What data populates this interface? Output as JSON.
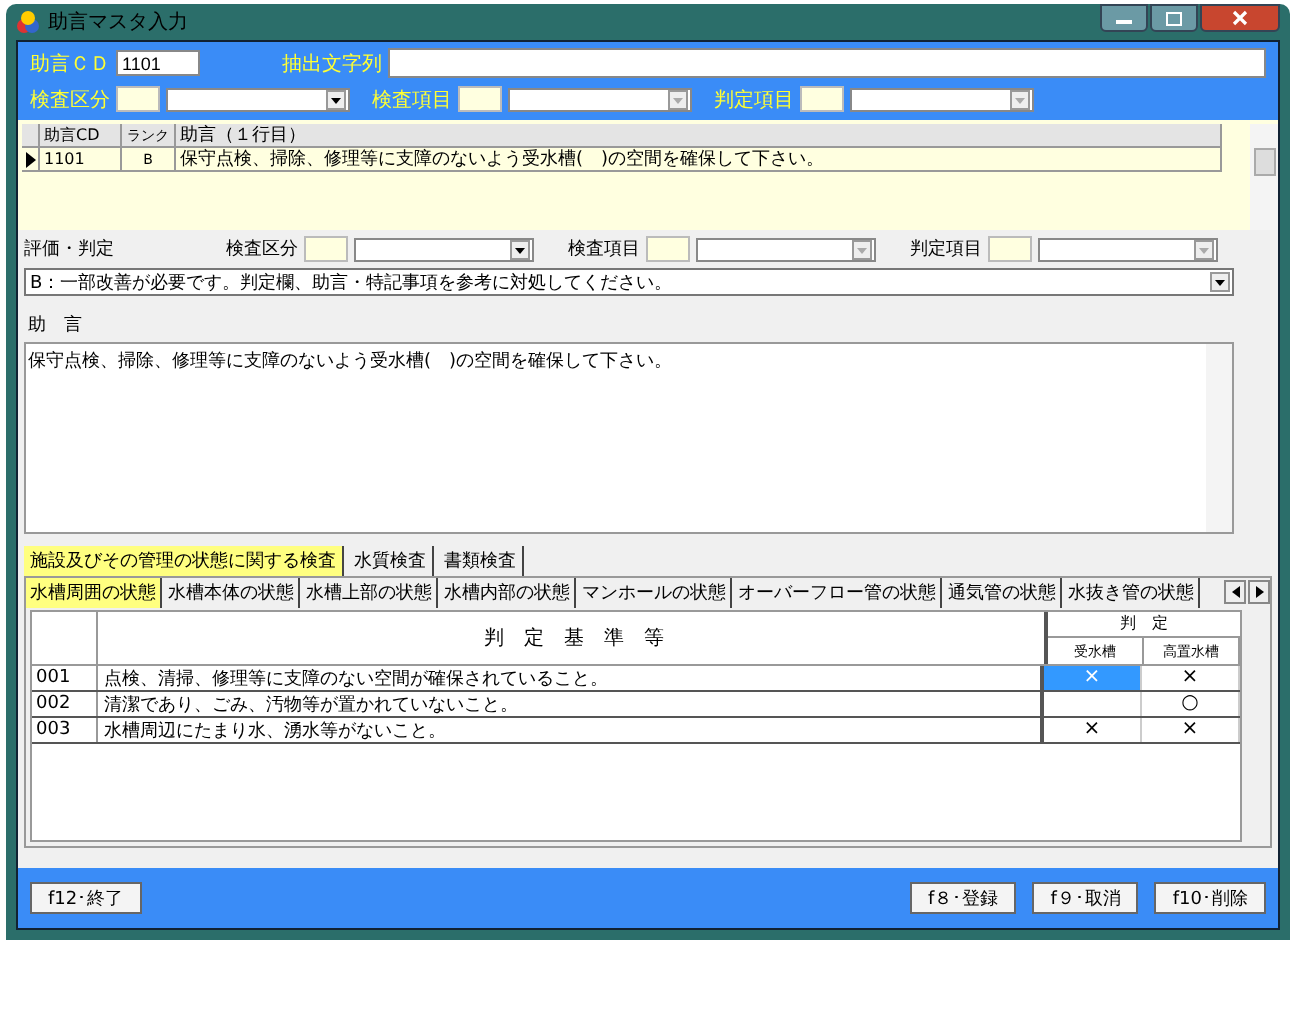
{
  "window": {
    "title": "助言マスタ入力"
  },
  "search": {
    "cd_label": "助言ＣＤ",
    "cd_value": "1101",
    "extract_label": "抽出文字列",
    "filters": [
      {
        "label": "検査区分",
        "disabled": false
      },
      {
        "label": "検査項目",
        "disabled": true
      },
      {
        "label": "判定項目",
        "disabled": true
      }
    ]
  },
  "grid": {
    "columns": [
      "助言CD",
      "ランク",
      "助言（１行目）"
    ],
    "rows": [
      {
        "selected": true,
        "cd": "1101",
        "rank": "B",
        "text": "保守点検、掃除、修理等に支障のないよう受水槽(　)の空間を確保して下さい。"
      }
    ]
  },
  "evaluation": {
    "label": "評価・判定",
    "filters": [
      {
        "label": "検査区分",
        "disabled": false
      },
      {
        "label": "検査項目",
        "disabled": true
      },
      {
        "label": "判定項目",
        "disabled": true
      }
    ],
    "judgement": "B：一部改善が必要です。判定欄、助言・特記事項を参考に対処してください。"
  },
  "advice": {
    "label": "助　言",
    "text": "保守点検、掃除、修理等に支障のないよう受水槽(　)の空間を確保して下さい。"
  },
  "tabs": [
    {
      "label": "施設及びその管理の状態に関する検査",
      "selected": true
    },
    {
      "label": "水質検査",
      "selected": false
    },
    {
      "label": "書類検査",
      "selected": false
    }
  ],
  "subtabs": [
    {
      "label": "水槽周囲の状態",
      "selected": true
    },
    {
      "label": "水槽本体の状態",
      "selected": false
    },
    {
      "label": "水槽上部の状態",
      "selected": false
    },
    {
      "label": "水槽内部の状態",
      "selected": false
    },
    {
      "label": "マンホールの状態",
      "selected": false
    },
    {
      "label": "オーバーフロー管の状態",
      "selected": false
    },
    {
      "label": "通気管の状態",
      "selected": false
    },
    {
      "label": "水抜き管の状態",
      "selected": false
    }
  ],
  "table": {
    "criteria_header": "判　定　基　準　等",
    "judge_header": "判　定",
    "judge_columns": [
      "受水槽",
      "高置水槽"
    ],
    "rows": [
      {
        "no": "001",
        "text": "点検、清掃、修理等に支障のない空間が確保されていること。",
        "cells": [
          {
            "mark": "×",
            "selected": true
          },
          {
            "mark": "×",
            "selected": false
          }
        ]
      },
      {
        "no": "002",
        "text": "清潔であり、ごみ、汚物等が置かれていないこと。",
        "cells": [
          {
            "selected": false
          },
          {
            "mark": "○",
            "selected": false
          }
        ]
      },
      {
        "no": "003",
        "text": "水槽周辺にたまり水、湧水等がないこと。",
        "cells": [
          {
            "mark": "×",
            "selected": false
          },
          {
            "mark": "×",
            "selected": false
          }
        ]
      }
    ]
  },
  "footer": {
    "left": [
      "f12･終了"
    ],
    "right": [
      "f８･登録",
      "f９･取消",
      "f10･削除"
    ]
  }
}
